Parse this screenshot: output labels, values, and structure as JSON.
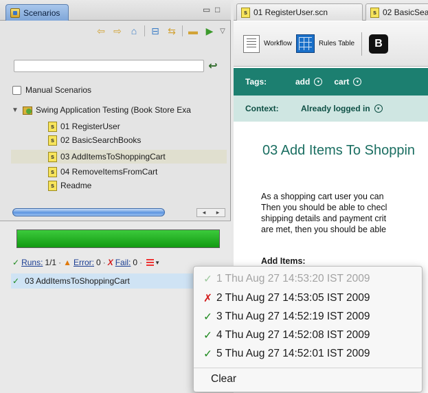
{
  "left_panel": {
    "view_tab": {
      "label": "Scenarios"
    },
    "window_controls": {
      "minimize": "▭",
      "maximize": "□"
    },
    "toolbar": {
      "buttons": [
        "back-arrow-icon",
        "forward-arrow-icon",
        "home-icon",
        "collapse-all-icon",
        "link-editor-icon",
        "tag-icon",
        "run-icon",
        "view-menu-icon"
      ]
    },
    "filter": {
      "value": "",
      "go_icon": "↩"
    },
    "manual_scenarios": {
      "label": "Manual Scenarios",
      "checked": false
    },
    "tree": {
      "root": {
        "label": "Swing Application Testing (Book Store Exa",
        "expanded": true
      },
      "items": [
        {
          "badge": "s",
          "label": "01 RegisterUser",
          "selected": false
        },
        {
          "badge": "s",
          "label": "02 BasicSearchBooks",
          "selected": false
        },
        {
          "badge": "s",
          "label": "03 AddItemsToShoppingCart",
          "selected": true
        },
        {
          "badge": "s",
          "label": "04 RemoveItemsFromCart",
          "selected": false
        },
        {
          "badge": "s",
          "label": "Readme",
          "selected": false
        }
      ]
    },
    "scrollbar": {
      "left_arrow": "◂",
      "right_arrow": "▸"
    },
    "runner": {
      "progress_fraction": 1.0,
      "counters": {
        "runs_label": "Runs:",
        "runs_value": "1/1",
        "error_label": "Error:",
        "error_value": "0",
        "fail_label": "Fail:",
        "fail_value": "0",
        "sep": "·"
      },
      "result": {
        "mark": "✓",
        "label": "03 AddItemsToShoppingCart"
      }
    }
  },
  "editor": {
    "tabs": [
      {
        "badge": "s",
        "label": "01 RegisterUser.scn"
      },
      {
        "badge": "s",
        "label": "02 BasicSea"
      }
    ],
    "tools": {
      "workflow_label": "Workflow",
      "rules_table_label": "Rules Table",
      "b_button": "B"
    },
    "tags": {
      "label": "Tags:",
      "items": [
        "add",
        "cart"
      ],
      "dropdown_glyph": "▾"
    },
    "context": {
      "label": "Context:",
      "value": "Already logged in"
    },
    "doc": {
      "title": "03  Add Items To Shoppin",
      "lines": [
        "As a shopping cart user you can",
        "Then you should be able to checl",
        "shipping details and payment crit",
        "are met, then you should be able"
      ],
      "subheading": "Add Items:"
    }
  },
  "history_popup": {
    "runs": [
      {
        "mark": "✓",
        "status": "passed",
        "text": "1 Thu Aug 27 14:53:20 IST 2009",
        "enabled": false
      },
      {
        "mark": "✗",
        "status": "failed",
        "text": "2 Thu Aug 27 14:53:05 IST 2009",
        "enabled": true
      },
      {
        "mark": "✓",
        "status": "passed",
        "text": "3 Thu Aug 27 14:52:19 IST 2009",
        "enabled": true
      },
      {
        "mark": "✓",
        "status": "passed",
        "text": "4 Thu Aug 27 14:52:08 IST 2009",
        "enabled": true
      },
      {
        "mark": "✓",
        "status": "passed",
        "text": "5 Thu Aug 27 14:52:01 IST 2009",
        "enabled": true
      }
    ],
    "clear_label": "Clear"
  },
  "colors": {
    "teal_bar": "#1c7f70",
    "context_bar": "#cfe6e2",
    "progress_green": "#22b222",
    "pass_green": "#1f8a1f",
    "fail_red": "#d31c1c"
  }
}
